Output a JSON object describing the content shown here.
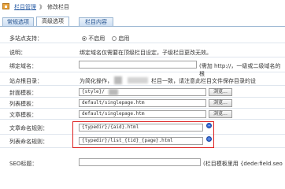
{
  "breadcrumb": {
    "link": "栏目管理",
    "sep": "》",
    "current": "修改栏目"
  },
  "tabs": [
    {
      "label": "常规选项",
      "active": false
    },
    {
      "label": "高级选项",
      "active": true
    },
    {
      "label": "栏目内容",
      "active": false
    }
  ],
  "rows": {
    "multi_site": {
      "label": "多站点支持：",
      "opt_off": "不启用",
      "opt_on": "启用",
      "selected": "不启用"
    },
    "note": {
      "label": "说明：",
      "text": "绑定域名仅需要在顶级栏目设定，子级栏目更改无效。"
    },
    "domain": {
      "label": "绑定域名：",
      "hint": "(需加 http://，一级或二级域名的根"
    },
    "site_root": {
      "label": "站点根目录：",
      "text_a": "为简化操作，",
      "text_b": "栏目一致，请注意此栏目文件保存目录的设"
    },
    "cover_tpl": {
      "label": "封面模板：",
      "value": "{style}/",
      "button": "浏览..."
    },
    "list_tpl": {
      "label": "列表模板：",
      "value": "default/singlepage.htm",
      "button": "浏览..."
    },
    "article_tpl": {
      "label": "文章模板：",
      "value": "default/singlepage.htm",
      "button": "浏览..."
    },
    "article_rule": {
      "label": "文章命名规则：",
      "value": "{typedir}/{aid}.html"
    },
    "list_rule": {
      "label": "列表命名规则：",
      "value": "{typedir}/list_{tid}_{page}.html"
    },
    "seo_title": {
      "label": "SEO标题：",
      "hint": "(栏目模板里用 {dede:field.seo"
    }
  }
}
